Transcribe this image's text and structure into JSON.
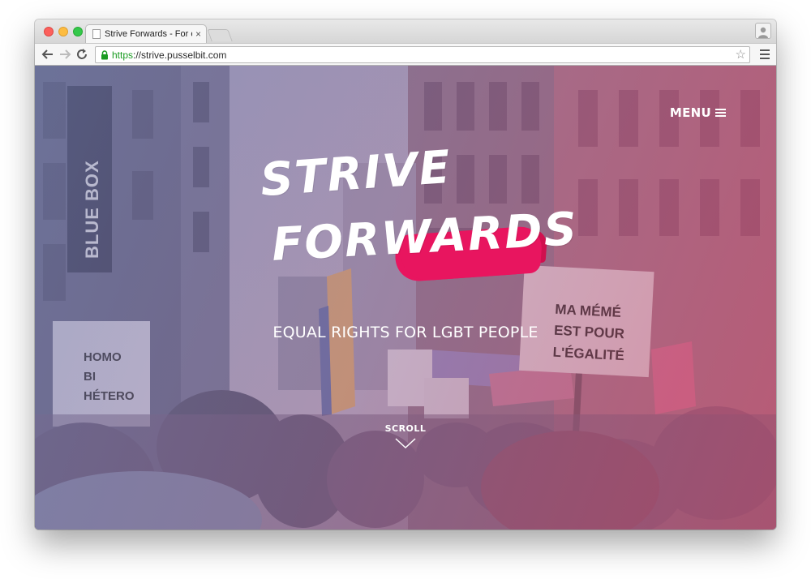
{
  "browser": {
    "tab_title": "Strive Forwards - For equal",
    "tab_close": "×",
    "url_scheme": "https",
    "url_rest": "://strive.pusselbit.com",
    "star": "☆"
  },
  "site": {
    "menu_label": "MENU",
    "logo_line1": "STRIVE",
    "logo_line2": "FORWARDS",
    "tagline": "EQUAL RIGHTS FOR LGBT PEOPLE",
    "scroll_label": "SCROLL",
    "accent_color": "#e8155f"
  },
  "photo_signs": {
    "store_sign": "BLUE BOX",
    "left_sign": [
      "HOMO",
      "BI",
      "HÉTERO"
    ],
    "right_sign": [
      "MA MÉMÉ",
      "EST POUR",
      "L'ÉGALITÉ"
    ]
  },
  "icons": [
    "back-arrow-icon",
    "forward-arrow-icon",
    "reload-icon",
    "lock-icon",
    "star-icon",
    "menu-icon",
    "profile-icon",
    "hamburger-icon",
    "chevron-down-icon"
  ]
}
